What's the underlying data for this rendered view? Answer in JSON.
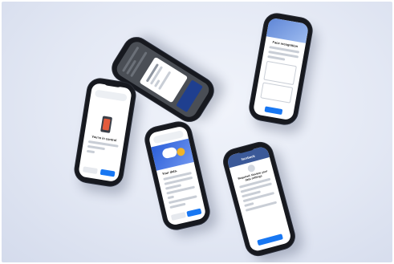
{
  "phones": {
    "control": {
      "title": "You're in control"
    },
    "data": {
      "title": "Your data."
    },
    "face": {
      "title": "Face recognition"
    },
    "facebook": {
      "brand": "facebook",
      "heading": "Required: Review your data settings"
    }
  },
  "colors": {
    "background": "#e3e8f4",
    "facebook_blue": "#1877f2",
    "phone_body": "#17191f"
  }
}
